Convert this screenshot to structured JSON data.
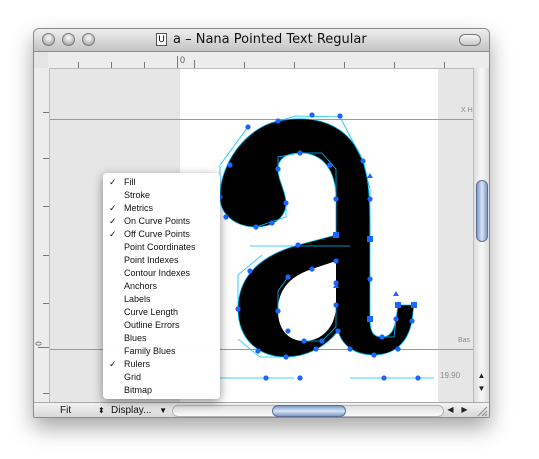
{
  "window": {
    "title": "a – Nana Pointed Text Regular",
    "doc_icon_glyph": "U"
  },
  "ruler": {
    "origin_label": "0"
  },
  "vruler": {
    "zero_label": "0"
  },
  "canvas": {
    "xheight_label": "X H",
    "baseline_label": "Bas",
    "coordinate_readout": "19.90",
    "ink_color": "#000000",
    "outline_color": "#00c0ff",
    "point_color": "#1a66ff"
  },
  "bottombar": {
    "zoom_label": "Fit",
    "display_label": "Display..."
  },
  "display_menu": {
    "items": [
      {
        "label": "Fill",
        "checked": true
      },
      {
        "label": "Stroke",
        "checked": false
      },
      {
        "label": "Metrics",
        "checked": true
      },
      {
        "label": "On Curve Points",
        "checked": true
      },
      {
        "label": "Off Curve Points",
        "checked": true
      },
      {
        "label": "Point Coordinates",
        "checked": false
      },
      {
        "label": "Point Indexes",
        "checked": false
      },
      {
        "label": "Contour Indexes",
        "checked": false
      },
      {
        "label": "Anchors",
        "checked": false
      },
      {
        "label": "Labels",
        "checked": false
      },
      {
        "label": "Curve Length",
        "checked": false
      },
      {
        "label": "Outline Errors",
        "checked": false
      },
      {
        "label": "Blues",
        "checked": false
      },
      {
        "label": "Family Blues",
        "checked": false
      },
      {
        "label": "Rulers",
        "checked": true
      },
      {
        "label": "Grid",
        "checked": false
      },
      {
        "label": "Bitmap",
        "checked": false
      }
    ]
  }
}
